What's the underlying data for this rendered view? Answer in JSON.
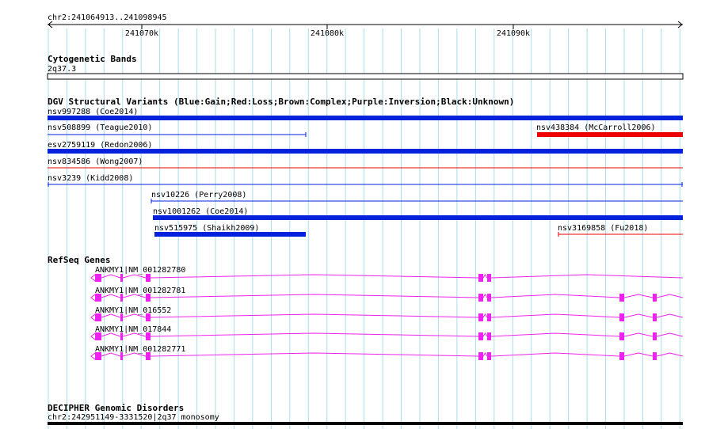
{
  "ruler": {
    "region": "chr2:241064913..241098945",
    "ticks": [
      "241070k",
      "241080k",
      "241090k"
    ]
  },
  "tracks": {
    "cytoband": {
      "title": "Cytogenetic Bands",
      "band": "2q37.3"
    },
    "dgv": {
      "title": "DGV Structural Variants (Blue:Gain;Red:Loss;Brown:Complex;Purple:Inversion;Black:Unknown)",
      "features": [
        {
          "label": "nsv997288 (Coe2014)",
          "color": "#0022dd",
          "style": "thick"
        },
        {
          "label": "nsv508899 (Teague2010)",
          "color": "#0022dd",
          "style": "thin"
        },
        {
          "label": "nsv438384 (McCarroll2006)",
          "color": "#ee0000",
          "style": "thick"
        },
        {
          "label": "esv2759119 (Redon2006)",
          "color": "#0022dd",
          "style": "thick"
        },
        {
          "label": "nsv834586 (Wong2007)",
          "color": "#ee0000",
          "style": "thin"
        },
        {
          "label": "nsv3239 (Kidd2008)",
          "color": "#0022dd",
          "style": "thin"
        },
        {
          "label": "nsv10226 (Perry2008)",
          "color": "#0022dd",
          "style": "thin"
        },
        {
          "label": "nsv1001262 (Coe2014)",
          "color": "#0022dd",
          "style": "thick"
        },
        {
          "label": "nsv515975 (Shaikh2009)",
          "color": "#0022dd",
          "style": "thick"
        },
        {
          "label": "nsv3169858 (Fu2018)",
          "color": "#ee0000",
          "style": "thin"
        }
      ]
    },
    "refseq": {
      "title": "RefSeq Genes",
      "color": "#ee22ee",
      "genes": [
        {
          "label": "ANKMY1|NM_001282780"
        },
        {
          "label": "ANKMY1|NM_001282781"
        },
        {
          "label": "ANKMY1|NM_016552"
        },
        {
          "label": "ANKMY1|NM_017844"
        },
        {
          "label": "ANKMY1|NM_001282771"
        }
      ]
    },
    "decipher": {
      "title": "DECIPHER Genomic Disorders",
      "feature": "chr2:242951149-3331520|2q37 monosomy"
    }
  },
  "colors": {
    "grid": "#aaddee",
    "gain": "#0022dd",
    "loss": "#ee0000",
    "gene": "#ee22ee",
    "text": "#000000"
  }
}
